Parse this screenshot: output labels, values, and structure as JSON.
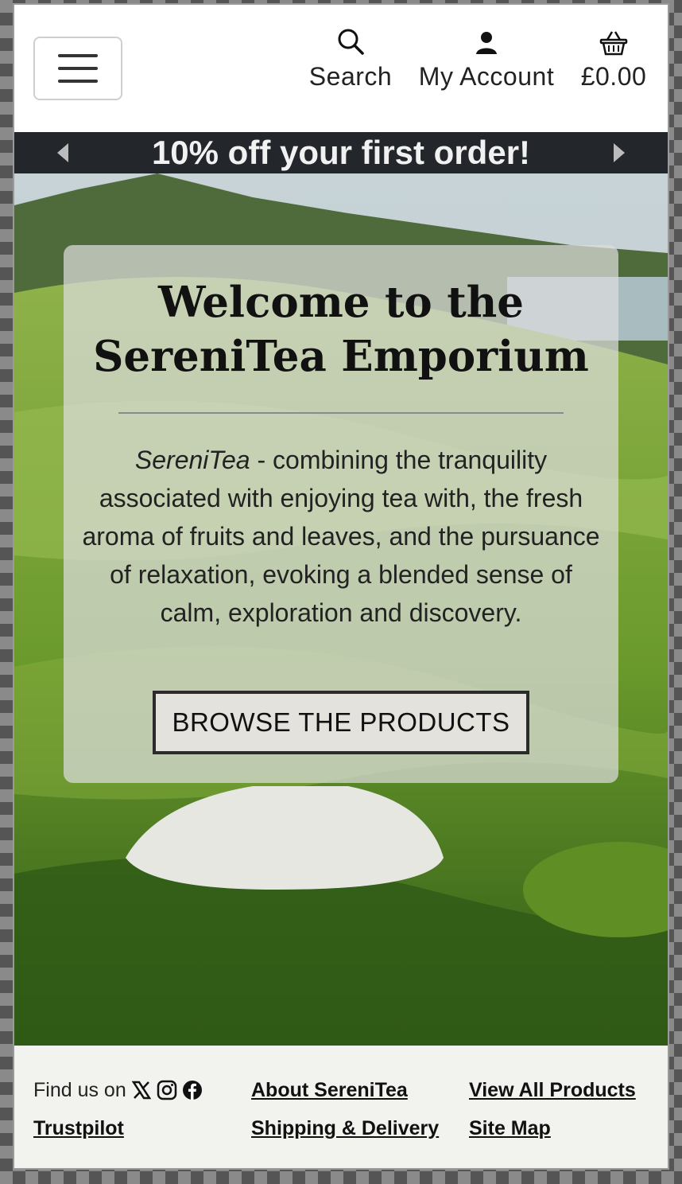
{
  "header": {
    "search_label": "Search",
    "account_label": "My Account",
    "cart_label": "£0.00"
  },
  "banner": {
    "text": "10% off your first order!"
  },
  "hero": {
    "title_line1": "Welcome to the",
    "title_line2": "SereniTea Emporium",
    "brand_italic": "SereniTea",
    "description": " - combining the tranquility associated with enjoying tea with, the fresh aroma of fruits and leaves, and the pursuance of relaxation, evoking a blended sense of calm, exploration and discovery.",
    "button_label": "BROWSE THE PRODUCTS"
  },
  "footer": {
    "find_us_label": "Find us on",
    "social_icons": [
      "x-icon",
      "instagram-icon",
      "facebook-icon"
    ],
    "trustpilot": "Trustpilot",
    "about": "About SereniTea",
    "shipping": "Shipping & Delivery",
    "all_products": "View All Products",
    "site_map": "Site Map"
  },
  "colors": {
    "banner_bg": "#23272b",
    "footer_bg": "#f2f2ef"
  }
}
